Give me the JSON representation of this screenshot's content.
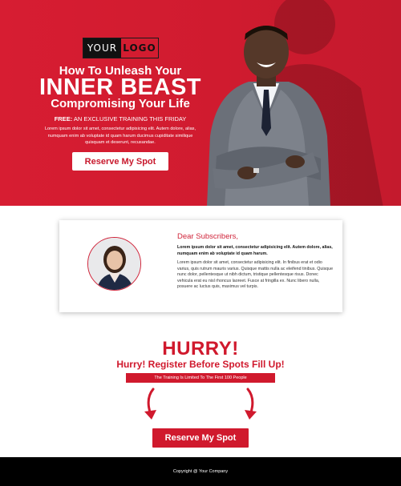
{
  "brand": {
    "logo_part1": "YOUR",
    "logo_part2": "LOGO"
  },
  "hero": {
    "title_line1": "How To Unleash Your",
    "title_line2": "INNER BEAST",
    "title_line3": "Compromising Your Life",
    "free_label": "FREE:",
    "free_text": "AN EXCLUSIVE TRAINING THIS FRIDAY",
    "body": "Lorem ipsum dolor sit amet, consectetur adipisicing elit. Autem dolore, alias, numquam enim ab voluptate id quam harum ducimus cupiditate similique quisquam et deserunt, recusandae.",
    "cta_label": "Reserve My Spot"
  },
  "letter": {
    "greeting": "Dear Subscribers,",
    "bold_text": "Lorem ipsum dolor sit amet, consectetur adipisicing elit. Autem dolore, alias, numquam enim ab voluptate id quam harum.",
    "body_text": "Lorem ipsum dolor sit amet, consectetur adipisicing elit. In finibus erat et odio varius, quis rutrum mauris varius. Quisque mattis nulla ac eleifend tinibus. Quisque nunc dolor, pellentesque ut nibh dictum, tristique pellentesque risus. Donec vehicula erat eu nisl rhoncus laoreet. Fusce at fringilla ex. Nunc libero nulla, posuere ac luctus quis, maximus vel turpis."
  },
  "urgency": {
    "hurry": "HURRY!",
    "register": "Hurry! Register Before Spots Fill Up!",
    "limited": "The Training Is Limited To The First 100 People",
    "cta_label": "Reserve My Spot"
  },
  "footer": {
    "copyright": "Copyright @ Your Company"
  },
  "colors": {
    "brand_red": "#d0192d",
    "footer_bg": "#000000"
  },
  "icons": {
    "left_arrow": "curved-arrow-down-icon",
    "right_arrow": "curved-arrow-down-icon"
  }
}
